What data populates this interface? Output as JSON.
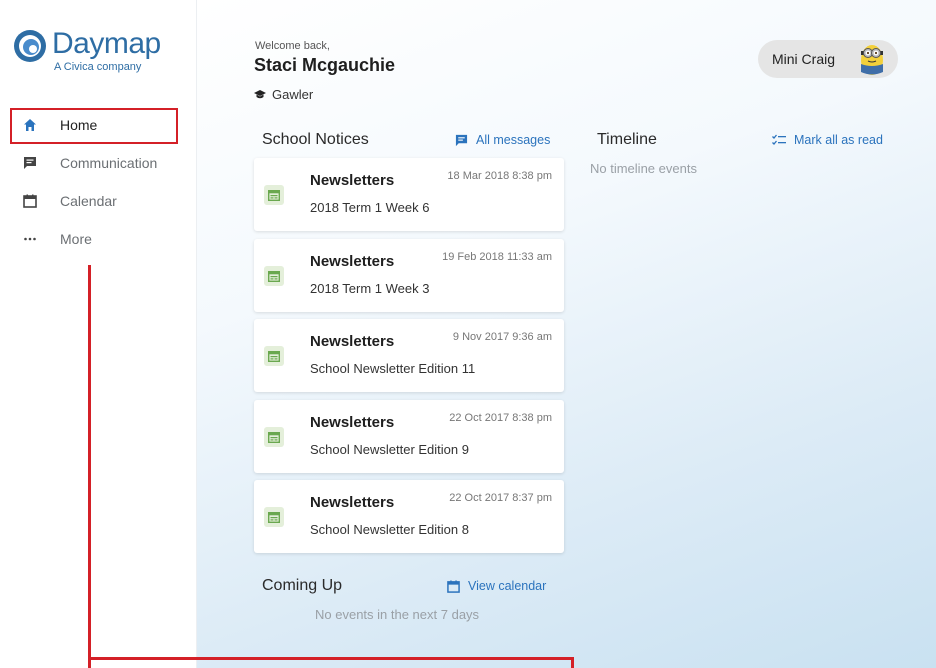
{
  "brand": {
    "name": "Daymap",
    "tagline": "A Civica company",
    "color": "#2e6da4"
  },
  "sidebar": {
    "items": [
      {
        "label": "Home",
        "icon": "home-icon",
        "active": true
      },
      {
        "label": "Communication",
        "icon": "message-icon"
      },
      {
        "label": "Calendar",
        "icon": "calendar-icon"
      },
      {
        "label": "More",
        "icon": "more-dots-icon"
      }
    ]
  },
  "header": {
    "welcome": "Welcome back,",
    "name": "Staci Mcgauchie",
    "school": "Gawler",
    "user_chip": "Mini Craig"
  },
  "notices": {
    "title": "School Notices",
    "link": "All messages",
    "items": [
      {
        "title": "Newsletters",
        "date": "18 Mar 2018 8:38 pm",
        "subtitle": "2018 Term 1 Week 6"
      },
      {
        "title": "Newsletters",
        "date": "19 Feb 2018 11:33 am",
        "subtitle": "2018 Term 1 Week 3"
      },
      {
        "title": "Newsletters",
        "date": "9 Nov 2017 9:36 am",
        "subtitle": "School Newsletter Edition 11"
      },
      {
        "title": "Newsletters",
        "date": "22 Oct 2017 8:38 pm",
        "subtitle": "School Newsletter Edition 9"
      },
      {
        "title": "Newsletters",
        "date": "22 Oct 2017 8:37 pm",
        "subtitle": "School Newsletter Edition 8"
      }
    ]
  },
  "timeline": {
    "title": "Timeline",
    "link": "Mark all as read",
    "empty": "No timeline events"
  },
  "coming_up": {
    "title": "Coming Up",
    "link": "View calendar",
    "empty": "No events in the next 7 days"
  },
  "colors": {
    "accent": "#2b73bd",
    "annotation_red": "#d42027",
    "notice_icon_bg": "#e4efda",
    "notice_icon": "#6aa84f"
  }
}
